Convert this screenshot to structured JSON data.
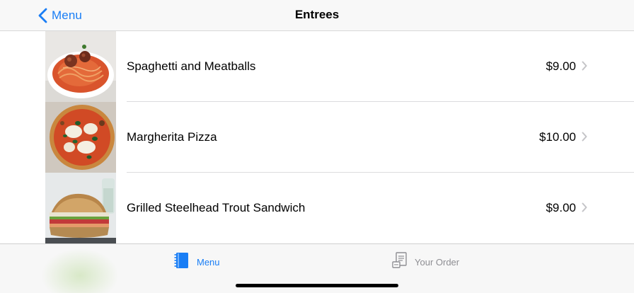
{
  "navbar": {
    "back_label": "Menu",
    "title": "Entrees",
    "accent_color": "#1a7ef5"
  },
  "items": [
    {
      "name": "Spaghetti and Meatballs",
      "price": "$9.00",
      "image": "spaghetti-photo"
    },
    {
      "name": "Margherita Pizza",
      "price": "$10.00",
      "image": "pizza-photo"
    },
    {
      "name": "Grilled Steelhead Trout Sandwich",
      "price": "$9.00",
      "image": "sandwich-photo"
    }
  ],
  "tabbar": {
    "tabs": [
      {
        "label": "Menu",
        "icon": "notebook-icon",
        "selected": true
      },
      {
        "label": "Your Order",
        "icon": "order-list-icon",
        "selected": false
      }
    ]
  }
}
